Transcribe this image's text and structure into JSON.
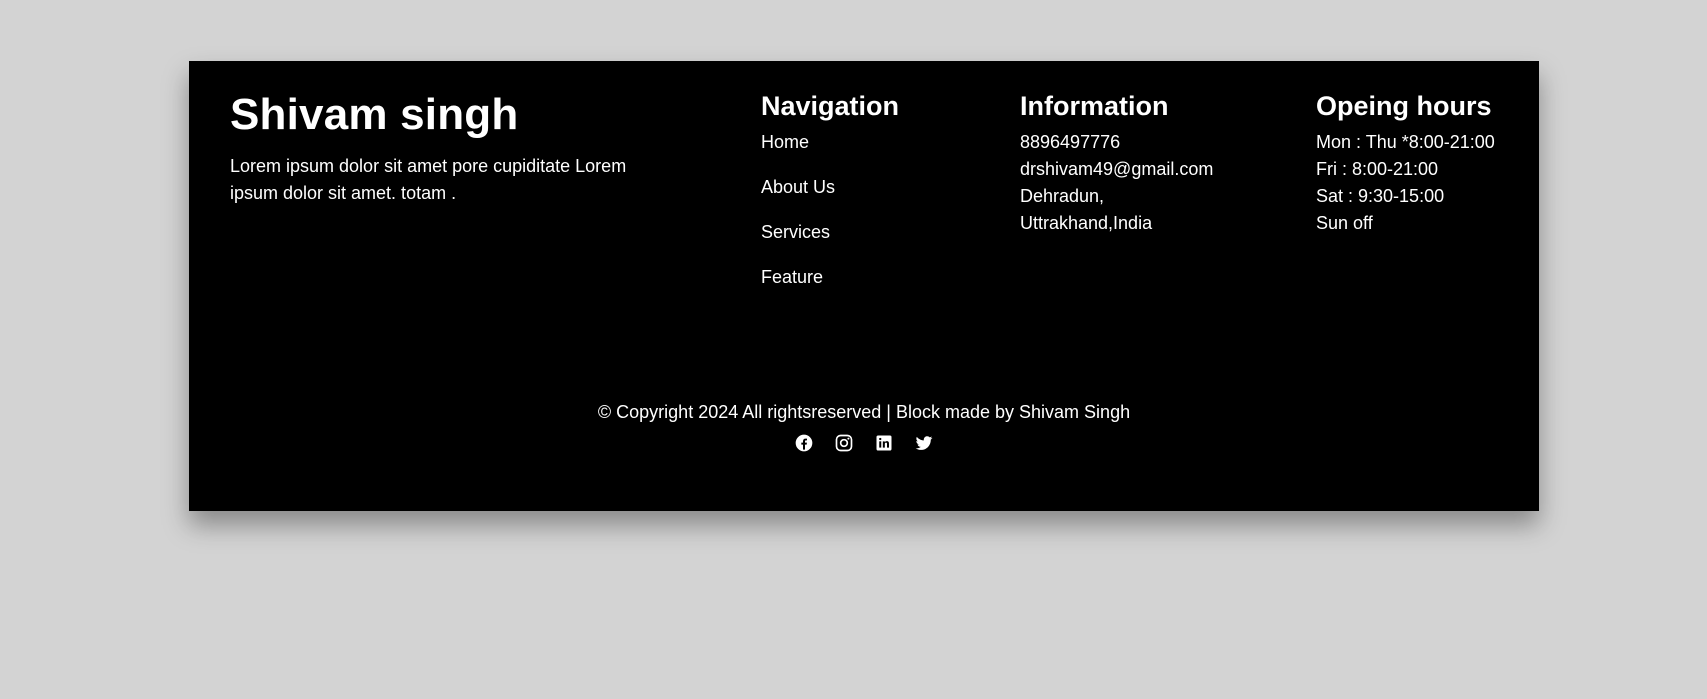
{
  "brand": {
    "name": "Shivam singh",
    "description": "Lorem ipsum dolor sit amet pore cupiditate Lorem ipsum dolor sit amet. totam ."
  },
  "navigation": {
    "heading": "Navigation",
    "links": [
      "Home",
      "About Us",
      "Services",
      "Feature"
    ]
  },
  "information": {
    "heading": "Information",
    "phone": "8896497776",
    "email": "drshivam49@gmail.com",
    "address_line1": "Dehradun,",
    "address_line2": "Uttrakhand,India"
  },
  "hours": {
    "heading": "Opeing hours",
    "lines": [
      "Mon : Thu *8:00-21:00",
      "Fri : 8:00-21:00",
      "Sat : 9:30-15:00",
      "Sun off"
    ]
  },
  "copyright": "© Copyright 2024 All rightsreserved | Block made by Shivam Singh",
  "social_icons": [
    "facebook-icon",
    "instagram-icon",
    "linkedin-icon",
    "twitter-icon"
  ],
  "colors": {
    "page_background": "#d3d3d3",
    "footer_background": "#000000",
    "text": "#ffffff"
  }
}
